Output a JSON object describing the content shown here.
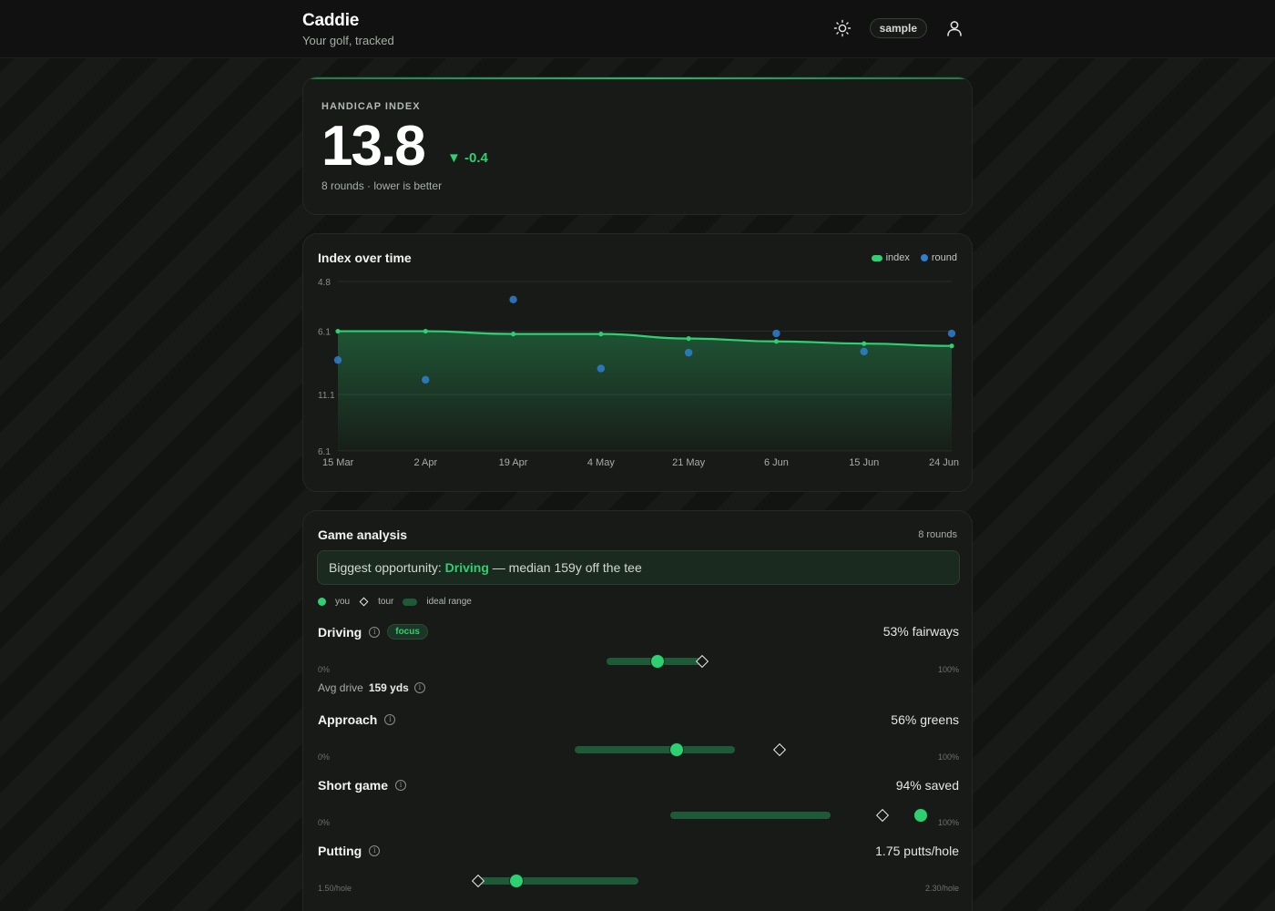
{
  "app": {
    "title": "Caddie",
    "subtitle": "Your golf, tracked",
    "user_pill": "sample"
  },
  "handicap": {
    "label": "HANDICAP INDEX",
    "value": "13.8",
    "delta": "▼ -0.4",
    "meta": "8 rounds · lower is better"
  },
  "chart": {
    "title": "Index over time",
    "legend": {
      "index": "index",
      "round": "round"
    },
    "colors": {
      "index": "#2fd072",
      "round": "#2f7fd0"
    }
  },
  "chart_data": {
    "type": "line",
    "title": "Index over time",
    "x": [
      "15 Mar",
      "2 Apr",
      "19 Apr",
      "4 May",
      "21 May",
      "6 Jun",
      "15 Jun",
      "24 Jun"
    ],
    "y_tick_labels": [
      "4.8",
      "6.1",
      "11.1",
      "6.1"
    ],
    "ylim": [
      0,
      3
    ],
    "grid": true,
    "legend_placement": "top-right",
    "series": [
      {
        "name": "index",
        "type": "area",
        "values": [
          2.12,
          2.12,
          2.07,
          2.07,
          1.99,
          1.94,
          1.9,
          1.86
        ]
      },
      {
        "name": "round",
        "type": "scatter",
        "values": [
          1.61,
          1.26,
          2.68,
          1.46,
          1.74,
          2.08,
          1.76,
          2.08
        ]
      }
    ]
  },
  "game": {
    "title": "Game analysis",
    "count": "8 rounds",
    "banner": {
      "prefix": "Biggest opportunity: ",
      "highlight": "Driving",
      "suffix": " — median 159y off the tee"
    },
    "legend": {
      "you": "you",
      "tour": "tour",
      "ideal": "ideal range"
    },
    "metrics": [
      {
        "name": "Driving",
        "tag": "focus",
        "stat": "53% fairways",
        "min": "0%",
        "max": "100%",
        "you": 0.53,
        "tour": 0.6,
        "ideal": [
          0.45,
          0.6
        ],
        "sub_label": "Avg drive",
        "sub_value": "159 yds"
      },
      {
        "name": "Approach",
        "stat": "56% greens",
        "min": "0%",
        "max": "100%",
        "you": 0.56,
        "tour": 0.72,
        "ideal": [
          0.4,
          0.65
        ]
      },
      {
        "name": "Short game",
        "stat": "94% saved",
        "min": "0%",
        "max": "100%",
        "you": 0.94,
        "tour": 0.88,
        "ideal": [
          0.55,
          0.8
        ]
      },
      {
        "name": "Putting",
        "stat": "1.75 putts/hole",
        "min": "1.50/hole",
        "max": "2.30/hole",
        "you": 0.31,
        "tour": 0.25,
        "ideal": [
          0.25,
          0.5
        ]
      }
    ]
  }
}
